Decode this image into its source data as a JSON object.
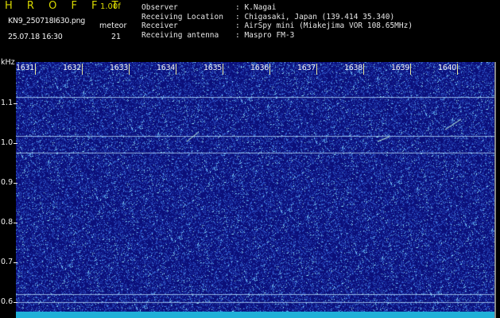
{
  "app": {
    "logo": "H R O F F T",
    "version": "1.00f",
    "filename": "KN9_250718I630.png",
    "timestamp": "25.07.18 16:30",
    "meteor_label": "meteor",
    "meteor_count": "21"
  },
  "header": {
    "labels": [
      "Observer",
      "Receiving Location",
      "Receiver",
      "Receiving antenna"
    ],
    "values": [
      ": K.Nagai",
      ": Chigasaki, Japan (139.414 35.340)",
      ": AirSpy mini (Miakejima VOR 108.65MHz)",
      ": Maspro FM-3"
    ]
  },
  "chart_data": {
    "type": "heatmap",
    "ylabel": "kHz",
    "y_ticks": [
      "1.1",
      "1.0",
      "0.9",
      "0.8",
      "0.7",
      "0.6"
    ],
    "x_ticks": [
      "1631",
      "1632",
      "1633",
      "1634",
      "1635",
      "1636",
      "1637",
      "1638",
      "1639",
      "1640"
    ],
    "x_range": [
      1630.6,
      1640.8
    ],
    "y_range": [
      0.575,
      1.205
    ],
    "horizontal_lines_khz": [
      1.116,
      1.018,
      0.976,
      0.62,
      0.6
    ],
    "colors": {
      "background": "#0b0f7a",
      "noise_low": "#3a6ad8",
      "noise_high": "#9ff0ff",
      "line": "#bfe6ff",
      "baseline": "#1fb0d8"
    }
  }
}
